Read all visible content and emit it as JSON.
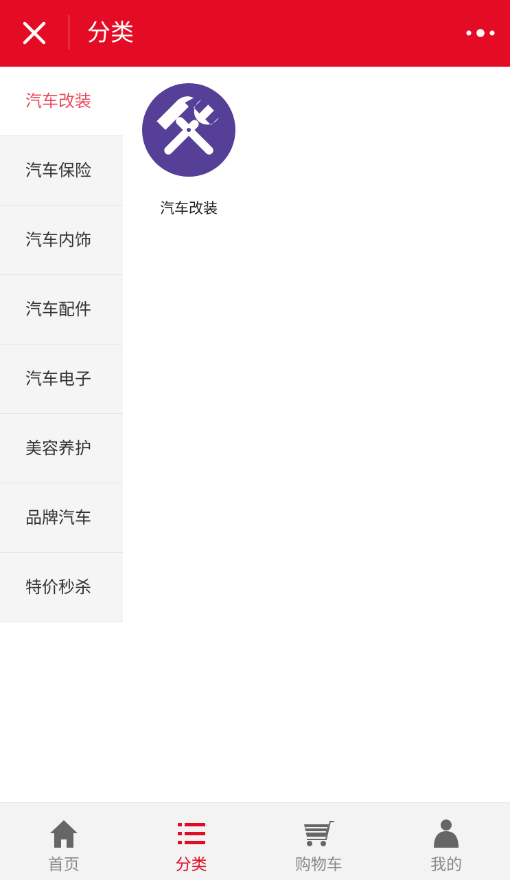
{
  "header": {
    "title": "分类",
    "color": "#e30c24"
  },
  "sidebar": {
    "items": [
      {
        "label": "汽车改装",
        "active": true
      },
      {
        "label": "汽车保险"
      },
      {
        "label": "汽车内饰"
      },
      {
        "label": "汽车配件"
      },
      {
        "label": "汽车电子"
      },
      {
        "label": "美容养护"
      },
      {
        "label": "品牌汽车"
      },
      {
        "label": "特价秒杀"
      }
    ],
    "active_color": "#e94a5a"
  },
  "content": {
    "categories": [
      {
        "label": "汽车改装",
        "icon": "wrench-hammer-icon",
        "icon_bg": "#553f97"
      }
    ]
  },
  "tabbar": {
    "items": [
      {
        "label": "首页",
        "icon": "home-icon"
      },
      {
        "label": "分类",
        "icon": "list-icon",
        "active": true
      },
      {
        "label": "购物车",
        "icon": "cart-icon"
      },
      {
        "label": "我的",
        "icon": "user-icon"
      }
    ]
  }
}
